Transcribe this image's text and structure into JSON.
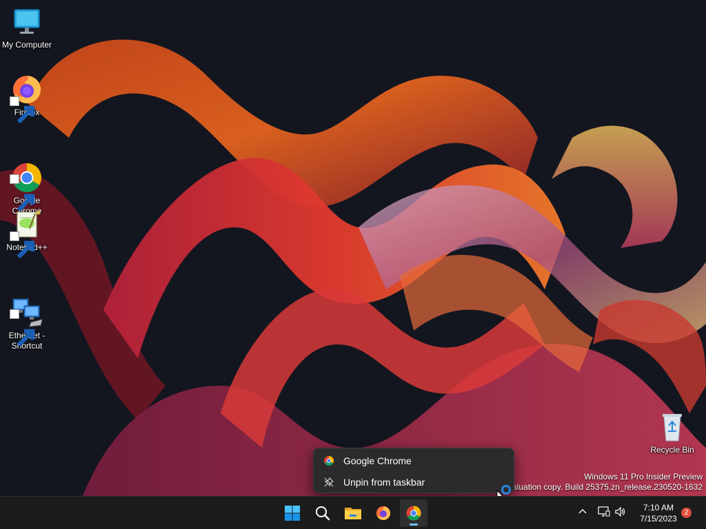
{
  "desktop": {
    "icons": [
      {
        "label": "My Computer"
      },
      {
        "label": "Firefox"
      },
      {
        "label": "Google\nChrome"
      },
      {
        "label": "Notepad++"
      },
      {
        "label": "Ethernet -\nShortcut"
      },
      {
        "label": "Recycle Bin"
      }
    ]
  },
  "watermark": {
    "line1": "Windows 11 Pro Insider Preview",
    "line2": "Evaluation copy. Build 25375.zn_release.230520-1632"
  },
  "context_menu": {
    "items": [
      {
        "label": "Google Chrome",
        "icon": "chrome-icon"
      },
      {
        "label": "Unpin from taskbar",
        "icon": "unpin-icon"
      }
    ]
  },
  "taskbar": {
    "apps": [
      "start-icon",
      "search-icon",
      "file-explorer-icon",
      "firefox-icon",
      "chrome-icon"
    ],
    "tray": [
      "chevron-up-icon",
      "network-icon",
      "volume-icon"
    ],
    "time": "7:10 AM",
    "date": "7/15/2023",
    "notification_count": "2"
  },
  "colors": {
    "accent": "#6cc6f7",
    "taskbar": "#1c1c1c",
    "menu": "#2b2b2b",
    "badge": "#e0503d"
  }
}
